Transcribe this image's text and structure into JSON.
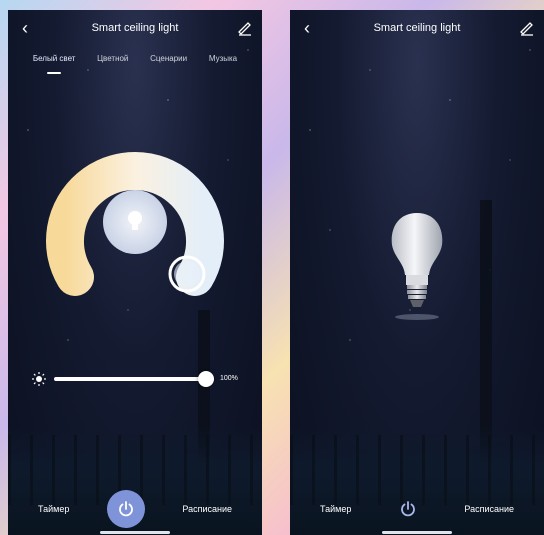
{
  "left_screen": {
    "title": "Smart ceiling light",
    "tabs": [
      {
        "label": "Белый свет",
        "active": true
      },
      {
        "label": "Цветной",
        "active": false
      },
      {
        "label": "Сценарии",
        "active": false
      },
      {
        "label": "Музыка",
        "active": false
      }
    ],
    "brightness": {
      "value": 1.0,
      "label": "100%"
    },
    "timer_label": "Таймер",
    "schedule_label": "Расписание",
    "power_state": "on"
  },
  "right_screen": {
    "title": "Smart ceiling light",
    "timer_label": "Таймер",
    "schedule_label": "Расписание",
    "power_state": "off"
  },
  "colors": {
    "accent": "#7f93d9",
    "warm": "#f7d99a",
    "cool": "#e8f2fb"
  },
  "icons": [
    "back-icon",
    "edit-icon",
    "lightbulb-icon",
    "sun-icon",
    "power-icon",
    "bulb-image"
  ]
}
